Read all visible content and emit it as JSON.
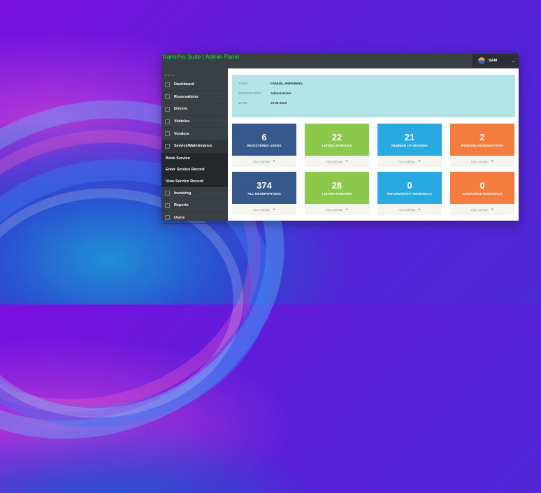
{
  "header": {
    "brand": "TransPro Suite | Admin Panel",
    "user": "SAM"
  },
  "sidebar": {
    "section": "MAIN",
    "items": [
      {
        "label": "Dashboard",
        "has_children": false
      },
      {
        "label": "Reservations",
        "has_children": true
      },
      {
        "label": "Drivers",
        "has_children": true
      },
      {
        "label": "Vehicles",
        "has_children": true
      },
      {
        "label": "Vendors",
        "has_children": true
      },
      {
        "label": "Service/Maintenance",
        "has_children": true
      }
    ],
    "subitems": [
      "Book Service",
      "Enter Service Record",
      "View Service Record"
    ],
    "items_after": [
      {
        "label": "Invoicing",
        "has_children": true
      },
      {
        "label": "Reports",
        "has_children": false
      },
      {
        "label": "Users",
        "has_children": true
      }
    ]
  },
  "info": {
    "user_label": "USER:",
    "user_value": "SAMUEL AMPABENG",
    "designation_label": "DESIGNATION:",
    "designation_value": "Administrator",
    "date_label": "DATE:",
    "date_value": "23-05-2024"
  },
  "cards": [
    {
      "value": "6",
      "label": "REGISTERED USERS",
      "footer": "FULL DETAIL",
      "color": "#34598a"
    },
    {
      "value": "22",
      "label": "LISTED VEHICLES",
      "footer": "FULL DETAIL",
      "color": "#8cc84b"
    },
    {
      "value": "21",
      "label": "NUMBER OF DRIVERS",
      "footer": "FULL DETAIL",
      "color": "#29a9e1"
    },
    {
      "value": "2",
      "label": "PENDING RESERVATIONS",
      "footer": "FULL DETAIL",
      "color": "#f47c3c"
    },
    {
      "value": "374",
      "label": "ALL RESERVATIONS",
      "footer": "FULL DETAIL",
      "color": "#34598a"
    },
    {
      "value": "28",
      "label": "LISTED VENDORS",
      "footer": "FULL DETAIL",
      "color": "#8cc84b"
    },
    {
      "value": "0",
      "label": "ROADWORTHY RENEWALS",
      "footer": "FULL DETAIL",
      "color": "#29a9e1"
    },
    {
      "value": "0",
      "label": "INSURANCE RENEWALS",
      "footer": "FULL DETAIL",
      "color": "#f47c3c"
    }
  ],
  "colors": {
    "accent_green": "#1ed760",
    "sidebar_bg": "#3a3f44",
    "info_bg": "#b2e4e8"
  }
}
